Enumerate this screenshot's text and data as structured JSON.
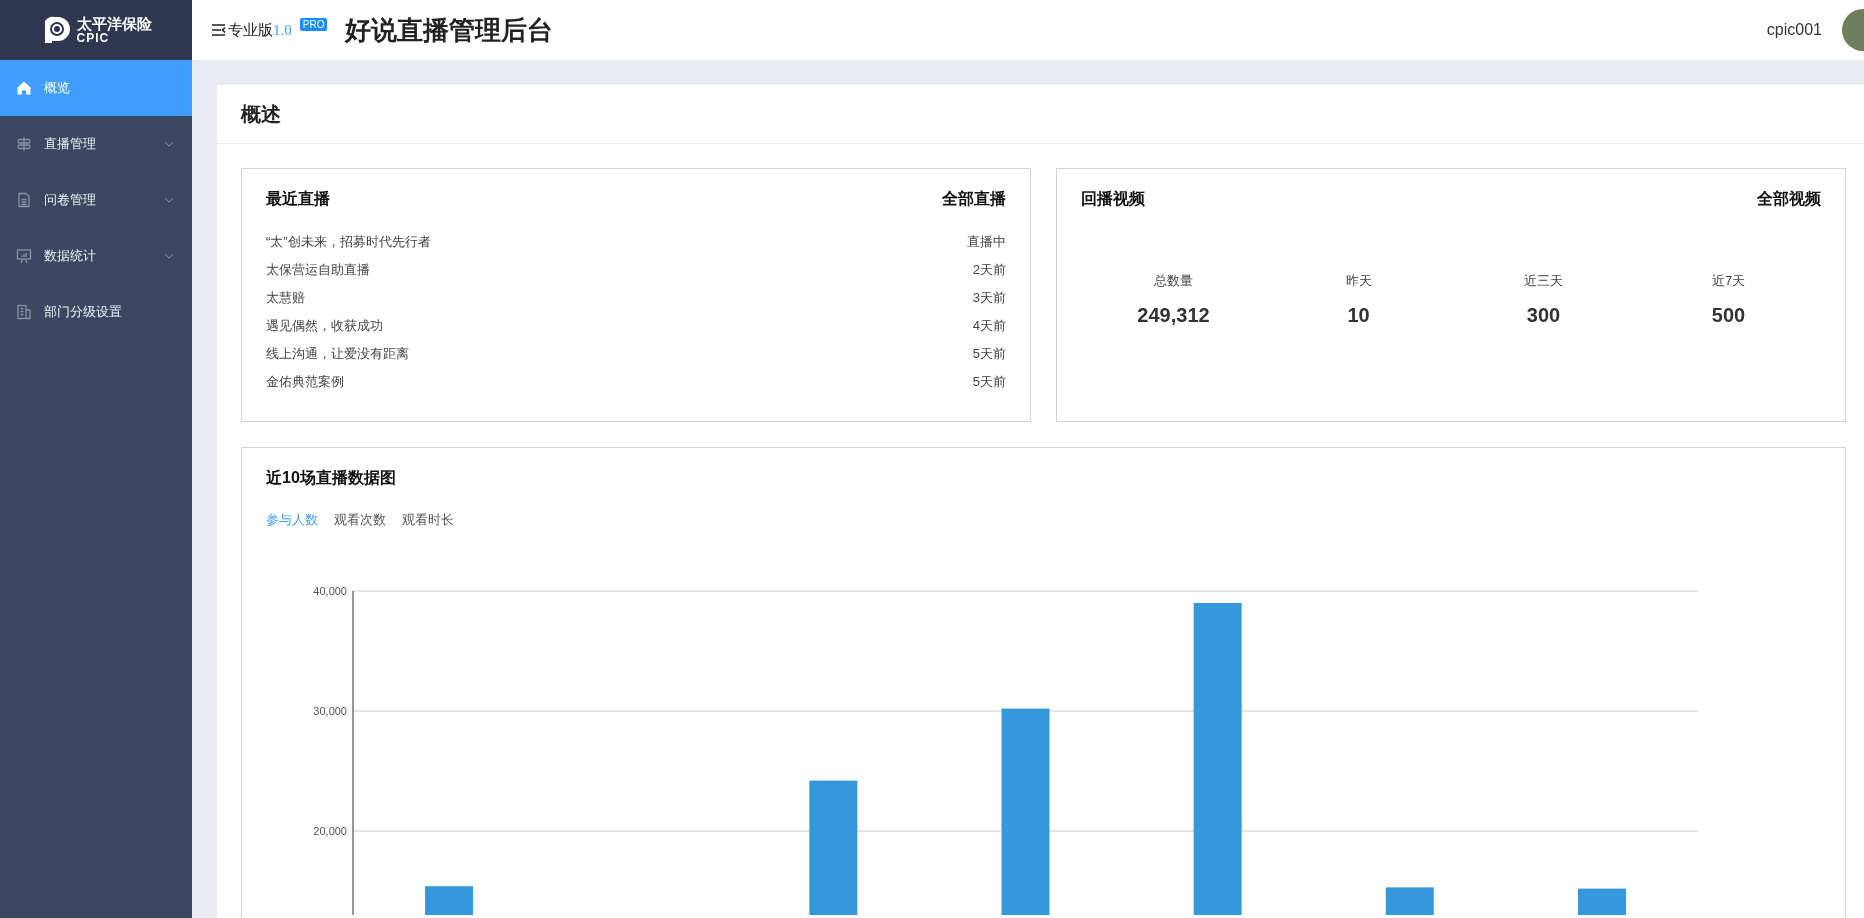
{
  "header": {
    "logo_text": "太平洋保险",
    "logo_subtext": "CPIC",
    "edition": "专业版",
    "version": "1.0",
    "badge": "PRO",
    "title": "好说直播管理后台",
    "username": "cpic001"
  },
  "sidebar": {
    "items": [
      {
        "label": "概览",
        "selected": true,
        "has_children": false
      },
      {
        "label": "直播管理",
        "selected": false,
        "has_children": true
      },
      {
        "label": "问卷管理",
        "selected": false,
        "has_children": true
      },
      {
        "label": "数据统计",
        "selected": false,
        "has_children": true
      },
      {
        "label": "部门分级设置",
        "selected": false,
        "has_children": false
      }
    ]
  },
  "page": {
    "title": "概述",
    "recent_live": {
      "title": "最近直播",
      "link": "全部直播",
      "items": [
        {
          "name": "“太”创未来，招募时代先行者",
          "time": "直播中"
        },
        {
          "name": "太保营运自助直播",
          "time": "2天前"
        },
        {
          "name": "太慧赔",
          "time": "3天前"
        },
        {
          "name": "遇见偶然，收获成功",
          "time": "4天前"
        },
        {
          "name": "线上沟通，让爱没有距离",
          "time": "5天前"
        },
        {
          "name": "金佑典范案例",
          "time": "5天前"
        }
      ]
    },
    "replay": {
      "title": "回播视频",
      "link": "全部视频",
      "stats": [
        {
          "label": "总数量",
          "value": "249,312"
        },
        {
          "label": "昨天",
          "value": "10"
        },
        {
          "label": "近三天",
          "value": "300"
        },
        {
          "label": "近7天",
          "value": "500"
        }
      ]
    },
    "chart_card": {
      "title": "近10场直播数据图",
      "tabs": [
        {
          "label": "参与人数",
          "selected": true
        },
        {
          "label": "观看次数",
          "selected": false
        },
        {
          "label": "观看时长",
          "selected": false
        }
      ],
      "chart_data": {
        "type": "bar",
        "ylim": [
          13000,
          40000
        ],
        "yticks": [
          {
            "value": 20000,
            "label": "20,000"
          },
          {
            "value": 30000,
            "label": "30,000"
          },
          {
            "value": 40000,
            "label": "40,000"
          }
        ],
        "series": [
          {
            "color": "#3498db",
            "values": [
              15400,
              null,
              24200,
              30200,
              39000,
              15300,
              15200
            ]
          }
        ]
      }
    }
  }
}
